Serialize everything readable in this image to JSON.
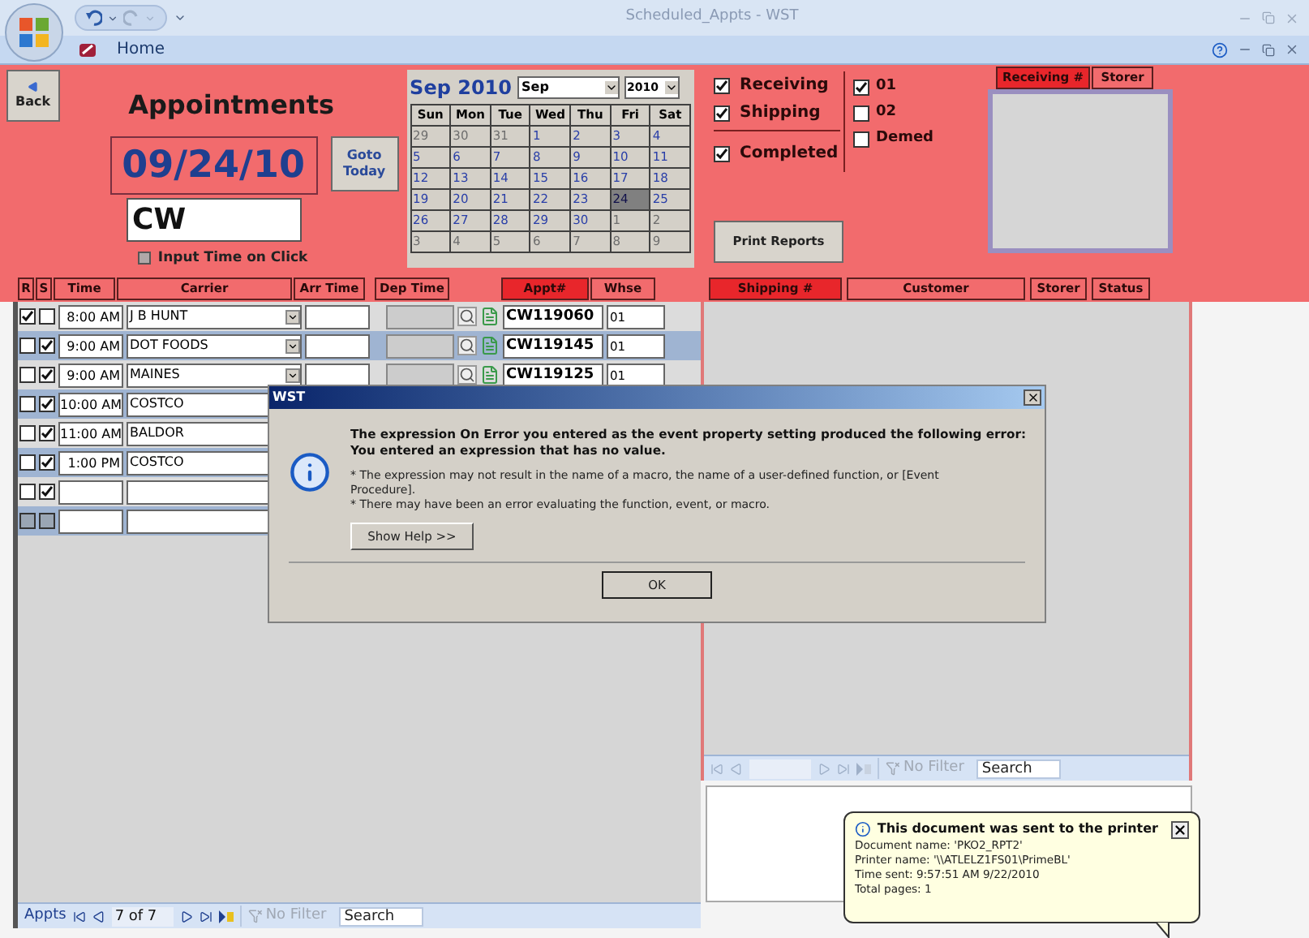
{
  "window": {
    "title": "Scheduled_Appts - WST",
    "ribbon_tab": "Home"
  },
  "left": {
    "back": "Back",
    "title": "Appointments",
    "date": "09/24/10",
    "goto": "Goto Today",
    "code": "CW",
    "input_time": {
      "label": "Input Time on Click",
      "checked": false
    },
    "calendar": {
      "heading": "Sep 2010",
      "month": "Sep",
      "year": "2010",
      "weekdays": [
        "Sun",
        "Mon",
        "Tue",
        "Wed",
        "Thu",
        "Fri",
        "Sat"
      ],
      "days": [
        {
          "d": "29",
          "in_month": false,
          "selected": false
        },
        {
          "d": "30",
          "in_month": false,
          "selected": false
        },
        {
          "d": "31",
          "in_month": false,
          "selected": false
        },
        {
          "d": "1",
          "in_month": true,
          "selected": false
        },
        {
          "d": "2",
          "in_month": true,
          "selected": false
        },
        {
          "d": "3",
          "in_month": true,
          "selected": false
        },
        {
          "d": "4",
          "in_month": true,
          "selected": false
        },
        {
          "d": "5",
          "in_month": true,
          "selected": false
        },
        {
          "d": "6",
          "in_month": true,
          "selected": false
        },
        {
          "d": "7",
          "in_month": true,
          "selected": false
        },
        {
          "d": "8",
          "in_month": true,
          "selected": false
        },
        {
          "d": "9",
          "in_month": true,
          "selected": false
        },
        {
          "d": "10",
          "in_month": true,
          "selected": false
        },
        {
          "d": "11",
          "in_month": true,
          "selected": false
        },
        {
          "d": "12",
          "in_month": true,
          "selected": false
        },
        {
          "d": "13",
          "in_month": true,
          "selected": false
        },
        {
          "d": "14",
          "in_month": true,
          "selected": false
        },
        {
          "d": "15",
          "in_month": true,
          "selected": false
        },
        {
          "d": "16",
          "in_month": true,
          "selected": false
        },
        {
          "d": "17",
          "in_month": true,
          "selected": false
        },
        {
          "d": "18",
          "in_month": true,
          "selected": false
        },
        {
          "d": "19",
          "in_month": true,
          "selected": false
        },
        {
          "d": "20",
          "in_month": true,
          "selected": false
        },
        {
          "d": "21",
          "in_month": true,
          "selected": false
        },
        {
          "d": "22",
          "in_month": true,
          "selected": false
        },
        {
          "d": "23",
          "in_month": true,
          "selected": false
        },
        {
          "d": "24",
          "in_month": true,
          "selected": true
        },
        {
          "d": "25",
          "in_month": true,
          "selected": false
        },
        {
          "d": "26",
          "in_month": true,
          "selected": false
        },
        {
          "d": "27",
          "in_month": true,
          "selected": false
        },
        {
          "d": "28",
          "in_month": true,
          "selected": false
        },
        {
          "d": "29",
          "in_month": true,
          "selected": false
        },
        {
          "d": "30",
          "in_month": true,
          "selected": false
        },
        {
          "d": "1",
          "in_month": false,
          "selected": false
        },
        {
          "d": "2",
          "in_month": false,
          "selected": false
        },
        {
          "d": "3",
          "in_month": false,
          "selected": false
        },
        {
          "d": "4",
          "in_month": false,
          "selected": false
        },
        {
          "d": "5",
          "in_month": false,
          "selected": false
        },
        {
          "d": "6",
          "in_month": false,
          "selected": false
        },
        {
          "d": "7",
          "in_month": false,
          "selected": false
        },
        {
          "d": "8",
          "in_month": false,
          "selected": false
        },
        {
          "d": "9",
          "in_month": false,
          "selected": false
        }
      ]
    },
    "columns": [
      {
        "label": "R",
        "highlighted": false
      },
      {
        "label": "S",
        "highlighted": false
      },
      {
        "label": "Time",
        "highlighted": false
      },
      {
        "label": "Carrier",
        "highlighted": false
      },
      {
        "label": "Arr Time",
        "highlighted": false
      },
      {
        "label": "Dep Time",
        "highlighted": false
      },
      {
        "label": "Appt#",
        "highlighted": true
      },
      {
        "label": "Whse",
        "highlighted": false
      }
    ],
    "rows": [
      {
        "r": true,
        "s": false,
        "disabled": false,
        "time": "8:00 AM",
        "carrier": "J B HUNT",
        "appt": "CW119060",
        "whse": "01"
      },
      {
        "r": false,
        "s": true,
        "disabled": false,
        "time": "9:00 AM",
        "carrier": "DOT FOODS",
        "appt": "CW119145",
        "whse": "01"
      },
      {
        "r": false,
        "s": true,
        "disabled": false,
        "time": "9:00 AM",
        "carrier": "MAINES",
        "appt": "CW119125",
        "whse": "01"
      },
      {
        "r": false,
        "s": true,
        "disabled": false,
        "time": "10:00 AM",
        "carrier": "COSTCO"
      },
      {
        "r": false,
        "s": true,
        "disabled": false,
        "time": "11:00 AM",
        "carrier": "BALDOR"
      },
      {
        "r": false,
        "s": true,
        "disabled": false,
        "time": "1:00 PM",
        "carrier": "COSTCO"
      },
      {
        "r": false,
        "s": true,
        "disabled": false
      },
      {
        "r": false,
        "s": false,
        "disabled": true
      }
    ],
    "nav": {
      "label": "Appts",
      "record": "7 of 7",
      "filter": "No Filter",
      "search": "Search"
    }
  },
  "right": {
    "filters": [
      {
        "label": "Receiving",
        "checked": true
      },
      {
        "label": "Shipping",
        "checked": true
      },
      {
        "label": "Completed",
        "checked": true
      }
    ],
    "warehouses": [
      {
        "label": "01",
        "checked": true
      },
      {
        "label": "02",
        "checked": false
      },
      {
        "label": "Demed",
        "checked": false
      }
    ],
    "print": "Print Reports",
    "list_columns": [
      {
        "label": "Receiving #",
        "highlighted": true
      },
      {
        "label": "Storer",
        "highlighted": false
      }
    ],
    "columns": [
      {
        "label": "Shipping #",
        "highlighted": true
      },
      {
        "label": "Customer",
        "highlighted": false
      },
      {
        "label": "Storer",
        "highlighted": false
      },
      {
        "label": "Status",
        "highlighted": false
      }
    ],
    "nav": {
      "filter": "No Filter",
      "search": "Search"
    }
  },
  "dialog": {
    "title": "WST",
    "message": [
      "The expression On Error you entered as the event property setting produced the following error:",
      "You entered an expression that has no value."
    ],
    "details": [
      "* The expression may not result in the name of a macro, the name of a user-defined function, or [Event Procedure].",
      "* There may have been an error evaluating the function, event, or macro."
    ],
    "help_button": "Show Help >>",
    "ok_button": "OK"
  },
  "balloon": {
    "title": "This document was sent to the printer",
    "lines": [
      "Document name: 'PKO2_RPT2'",
      "Printer name: '\\\\ATLELZ1FS01\\PrimeBL'",
      "Time sent: 9:57:51 AM  9/22/2010",
      "Total pages: 1"
    ]
  }
}
